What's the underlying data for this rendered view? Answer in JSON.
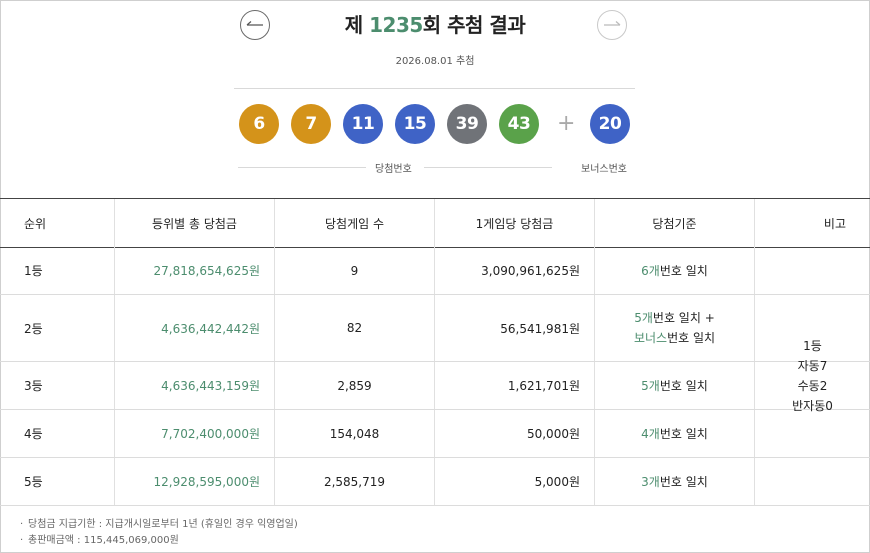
{
  "header": {
    "title_prefix": "제 ",
    "round": "1235",
    "title_suffix": "회 추첨 결과",
    "draw_date": "2026.08.01 추첨",
    "prev_icon": "arrow-left-icon",
    "next_icon": "arrow-right-icon"
  },
  "numbers": {
    "winning": [
      "6",
      "7",
      "11",
      "15",
      "39",
      "43"
    ],
    "bonus": "20",
    "plus": "+",
    "winning_label": "당첨번호",
    "bonus_label": "보너스번호",
    "colors": {
      "yellow": "#d4931a",
      "blue": "#3f63c6",
      "gray": "#707378",
      "green": "#5aa24a"
    }
  },
  "table": {
    "headers": [
      "순위",
      "등위별 총 당첨금",
      "당첨게임 수",
      "1게임당 당첨금",
      "당첨기준",
      "비고"
    ],
    "rows": [
      {
        "rank": "1등",
        "total": "27,818,654,625원",
        "count": "9",
        "per_game": "3,090,961,625원",
        "crit_num": "6개",
        "crit_text": "번호 일치",
        "crit_num2": "",
        "crit_text2": ""
      },
      {
        "rank": "2등",
        "total": "4,636,442,442원",
        "count": "82",
        "per_game": "56,541,981원",
        "crit_num": "5개",
        "crit_text": "번호 일치 +",
        "crit_num2": "보너스",
        "crit_text2": "번호 일치"
      },
      {
        "rank": "3등",
        "total": "4,636,443,159원",
        "count": "2,859",
        "per_game": "1,621,701원",
        "crit_num": "5개",
        "crit_text": "번호 일치",
        "crit_num2": "",
        "crit_text2": ""
      },
      {
        "rank": "4등",
        "total": "7,702,400,000원",
        "count": "154,048",
        "per_game": "50,000원",
        "crit_num": "4개",
        "crit_text": "번호 일치",
        "crit_num2": "",
        "crit_text2": ""
      },
      {
        "rank": "5등",
        "total": "12,928,595,000원",
        "count": "2,585,719",
        "per_game": "5,000원",
        "crit_num": "3개",
        "crit_text": "번호 일치",
        "crit_num2": "",
        "crit_text2": ""
      }
    ],
    "note_lines": [
      "1등",
      "자동7",
      "수동2",
      "반자동0"
    ]
  },
  "footer": {
    "line1": "당첨금 지급기한 : 지급개시일로부터 1년 (휴일인 경우 익영업일)",
    "line2": "총판매금액 : 115,445,069,000원"
  }
}
